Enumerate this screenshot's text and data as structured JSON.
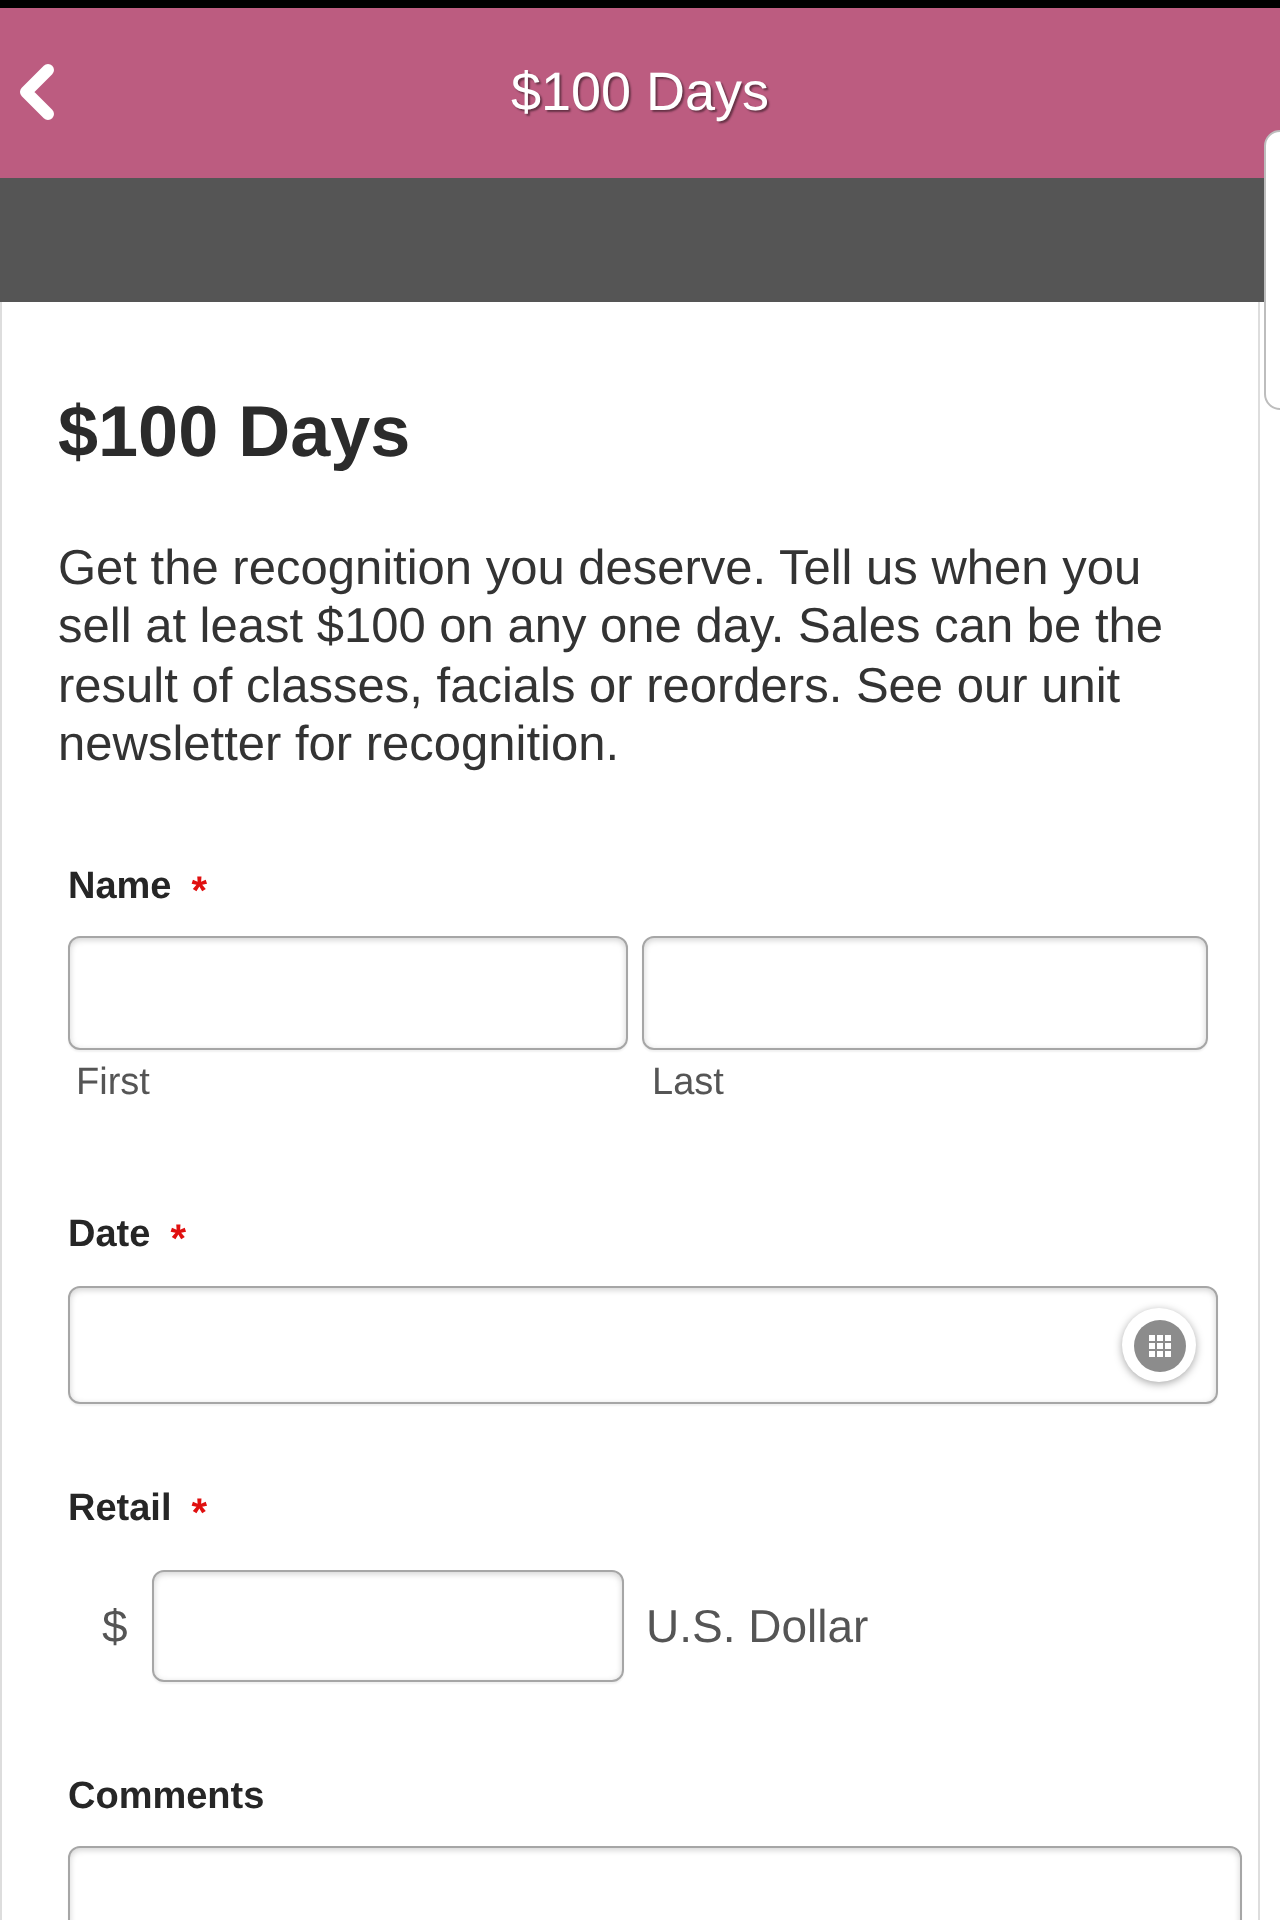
{
  "header": {
    "title": "$100 Days"
  },
  "page": {
    "heading": "$100 Days",
    "intro": "Get the recognition you deserve. Tell us when you sell at least $100 on any one day. Sales can be the result of classes, facials or reorders. See our unit newsletter for recognition."
  },
  "required_mark": "*",
  "fields": [
    {
      "kind": "name",
      "label": "Name",
      "required": true,
      "parts": [
        {
          "sublabel": "First"
        },
        {
          "sublabel": "Last"
        }
      ]
    },
    {
      "kind": "date",
      "label": "Date",
      "required": true
    },
    {
      "kind": "currency",
      "label": "Retail",
      "required": true,
      "prefix": "$",
      "suffix": "U.S. Dollar"
    },
    {
      "kind": "textarea",
      "label": "Comments",
      "required": false
    }
  ]
}
